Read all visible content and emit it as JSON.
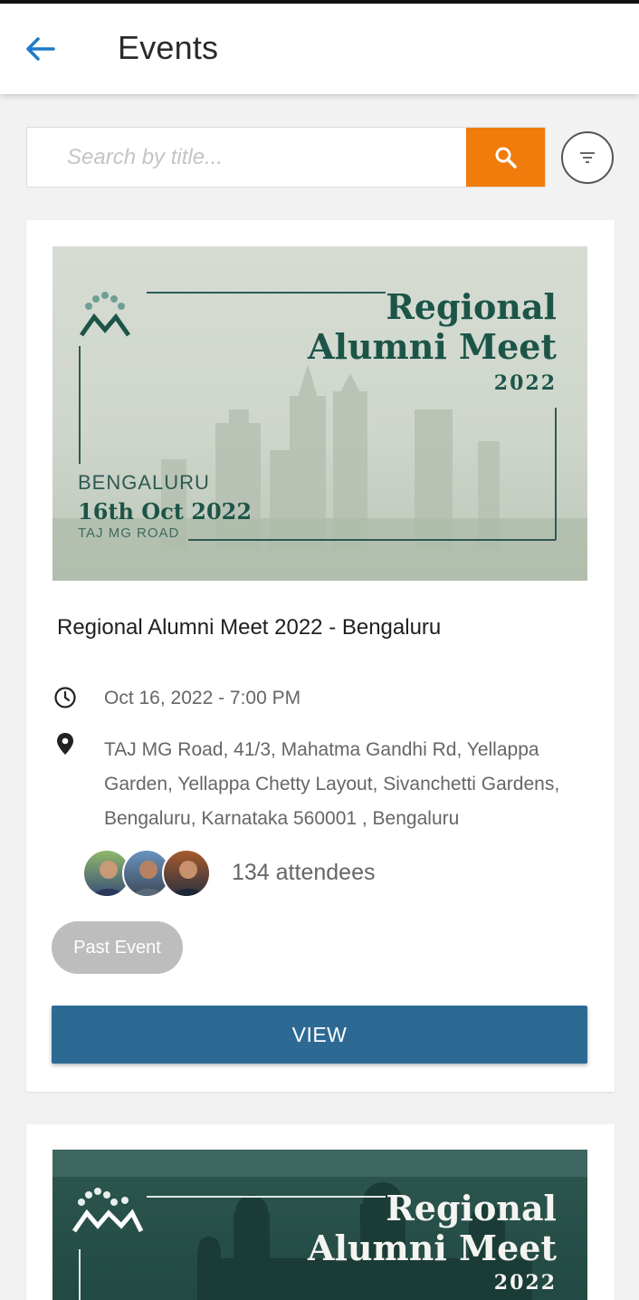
{
  "header": {
    "title": "Events"
  },
  "search": {
    "placeholder": "Search by title..."
  },
  "events": [
    {
      "banner": {
        "title_line1": "Regional",
        "title_line2": "Alumni Meet",
        "year": "2022",
        "city": "BENGALURU",
        "date": "16th Oct 2022",
        "venue": "TAJ MG ROAD"
      },
      "title": "Regional Alumni Meet 2022 - Bengaluru",
      "datetime": "Oct 16, 2022 - 7:00 PM",
      "address": "TAJ MG Road, 41/3, Mahatma Gandhi Rd, Yellappa Garden, Yellappa Chetty Layout, Sivanchetti Gardens, Bengaluru, Karnataka 560001 , Bengaluru",
      "attendees": "134 attendees",
      "status": "Past Event",
      "action_label": "VIEW"
    },
    {
      "banner": {
        "title_line1": "Regional",
        "title_line2": "Alumni Meet",
        "year": "2022"
      }
    }
  ],
  "colors": {
    "accent_orange": "#f07c0c",
    "view_button": "#2c6a94",
    "back_arrow": "#1e7ac8",
    "badge_grey": "#bdbdbd"
  },
  "icons": [
    "back-arrow-icon",
    "search-icon",
    "filter-icon",
    "clock-icon",
    "location-pin-icon",
    "alumni-logo-icon"
  ]
}
